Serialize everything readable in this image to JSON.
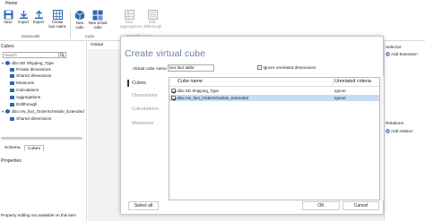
{
  "ribbon": {
    "tab": "Home",
    "buttons": [
      {
        "label": "Save",
        "icon": "save-icon"
      },
      {
        "label": "Import",
        "icon": "import-icon"
      },
      {
        "label": "Export",
        "icon": "export-icon"
      },
      {
        "label": "Create bus matrix",
        "icon": "bus-matrix-icon"
      },
      {
        "label": "New cube",
        "icon": "new-cube-icon"
      },
      {
        "label": "New virtual cube",
        "icon": "new-virtual-cube-icon"
      },
      {
        "label": "New aggregations",
        "icon": "new-aggregations-icon"
      },
      {
        "label": "Edit drillthrough",
        "icon": "edit-drillthrough-icon"
      }
    ],
    "groups": {
      "datamodel": "Datamodel",
      "cube": "Cube",
      "misc": "Miscellaneous"
    }
  },
  "left_panel": {
    "title": "Cubes",
    "search_placeholder": "Search",
    "tree": [
      {
        "label": "dbo.SD Shipping_Type",
        "kind": "cube"
      },
      {
        "label": "Private dimensions",
        "kind": "folder"
      },
      {
        "label": "Shared dimensions",
        "kind": "folder"
      },
      {
        "label": "Measures",
        "kind": "folder"
      },
      {
        "label": "Calculations",
        "kind": "folder"
      },
      {
        "label": "Aggregations",
        "kind": "folder"
      },
      {
        "label": "Drillthrough",
        "kind": "folder"
      },
      {
        "label": "dbo.Vw_fact_OrderSchedule_Extended",
        "kind": "cube"
      },
      {
        "label": "Shared dimensions",
        "kind": "folder"
      }
    ],
    "tabs": [
      "Schema",
      "Cubes"
    ],
    "properties_title": "Properties",
    "properties_status": "Property editing not available on this item"
  },
  "center": {
    "tab": "Global"
  },
  "right_panel": {
    "title": "Selector",
    "add_extension": "Add Extension",
    "relations_title": "Relations",
    "add_relation": "Add relation"
  },
  "dialog": {
    "title": "Create virtual cube",
    "nav": [
      "Cubes",
      "Dimensions",
      "Calculations",
      "Measures"
    ],
    "name_label": "Virtual cube name",
    "name_value": "two fact table",
    "ignore_label": "Ignore unrelated dimensions",
    "ignore_checked": false,
    "columns": [
      "Cube name",
      "Unrelated criteria"
    ],
    "rows": [
      {
        "name": "dbo.SD Shipping_Type",
        "criteria": "Ignore",
        "checked": true
      },
      {
        "name": "dbo.Vw_fact_OrderSchedule_Extended",
        "criteria": "Ignore",
        "checked": true
      }
    ],
    "select_all": "Select all",
    "ok": "OK",
    "cancel": "Cancel"
  },
  "colors": {
    "accent": "#2f66b3",
    "dialog_title": "#6c7fa8",
    "selection": "#c5dcf3",
    "workspace": "#f2f2f2"
  }
}
